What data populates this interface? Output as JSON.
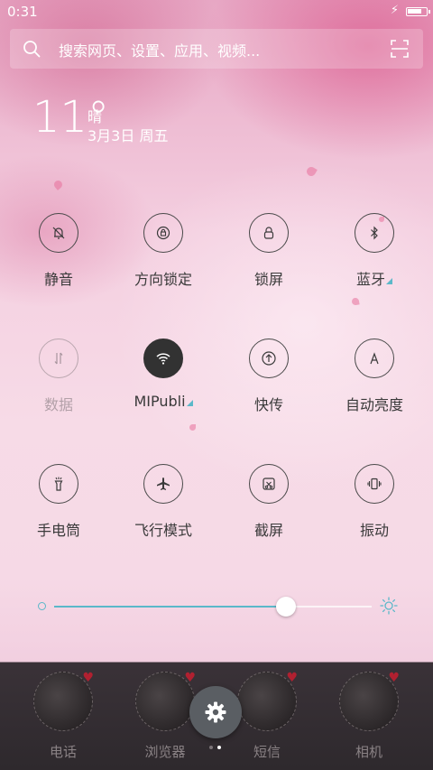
{
  "status_bar": {
    "time": "0:31",
    "battery_level": 0.8
  },
  "search": {
    "placeholder": "搜索网页、设置、应用、视频..."
  },
  "weather": {
    "temperature": "11°",
    "condition": "晴",
    "date": "3月3日 周五"
  },
  "toggles": [
    {
      "label": "静音",
      "icon": "bell-off-icon",
      "active": false,
      "dim": false
    },
    {
      "label": "方向锁定",
      "icon": "rotation-lock-icon",
      "active": false,
      "dim": false
    },
    {
      "label": "锁屏",
      "icon": "lock-icon",
      "active": false,
      "dim": false
    },
    {
      "label": "蓝牙",
      "icon": "bluetooth-icon",
      "active": false,
      "dim": false,
      "has_more": true
    },
    {
      "label": "数据",
      "icon": "mobile-data-icon",
      "active": false,
      "dim": true
    },
    {
      "label": "MIPubli",
      "icon": "wifi-icon",
      "active": true,
      "dim": false,
      "has_more": true
    },
    {
      "label": "快传",
      "icon": "quick-transfer-icon",
      "active": false,
      "dim": false
    },
    {
      "label": "自动亮度",
      "icon": "auto-brightness-icon",
      "active": false,
      "dim": false
    },
    {
      "label": "手电筒",
      "icon": "flashlight-icon",
      "active": false,
      "dim": false
    },
    {
      "label": "飞行模式",
      "icon": "airplane-icon",
      "active": false,
      "dim": false
    },
    {
      "label": "截屏",
      "icon": "screenshot-icon",
      "active": false,
      "dim": false
    },
    {
      "label": "振动",
      "icon": "vibrate-icon",
      "active": false,
      "dim": false
    }
  ],
  "brightness": {
    "level": 0.73
  },
  "dock": [
    {
      "label": "电话",
      "icon": "phone-app-icon"
    },
    {
      "label": "浏览器",
      "icon": "browser-app-icon"
    },
    {
      "label": "短信",
      "icon": "messages-app-icon"
    },
    {
      "label": "相机",
      "icon": "camera-app-icon"
    }
  ],
  "page_indicator": {
    "count": 2,
    "current": 2
  },
  "colors": {
    "accent": "#5bb8c9",
    "active_toggle": "#323232",
    "icon_stroke": "#3a3a3a"
  }
}
